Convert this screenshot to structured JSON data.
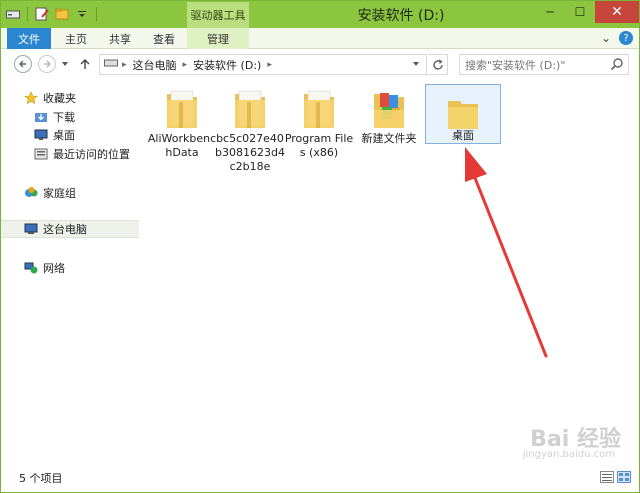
{
  "window": {
    "title": "安装软件 (D:)",
    "context_tab": "驱动器工具",
    "controls": {
      "minimize": "─",
      "maximize": "☐",
      "close": "✕"
    }
  },
  "ribbon": {
    "tabs": [
      "文件",
      "主页",
      "共享",
      "查看",
      "管理"
    ],
    "expand_glyph": "⌄",
    "help_glyph": "?"
  },
  "address": {
    "crumbs": [
      "这台电脑",
      "安装软件 (D:)"
    ],
    "search_placeholder": "搜索\"安装软件 (D:)\""
  },
  "nav_pane": {
    "favorites_label": "收藏夹",
    "favorites": [
      "下载",
      "桌面",
      "最近访问的位置"
    ],
    "homegroup": "家庭组",
    "this_pc": "这台电脑",
    "network": "网络"
  },
  "files": [
    {
      "name": "AliWorkbenchData",
      "icon": "folder-icon"
    },
    {
      "name": "bc5c027e40b3081623d4c2b18e",
      "icon": "folder-icon"
    },
    {
      "name": "Program Files (x86)",
      "icon": "folder-icon"
    },
    {
      "name": "新建文件夹",
      "icon": "folder-colorful-icon"
    },
    {
      "name": "桌面",
      "icon": "folder-icon",
      "selected": true
    }
  ],
  "status": {
    "item_count": "5 个项目"
  },
  "watermark": {
    "brand": "Bai 经验",
    "url": "jingyan.baidu.com"
  },
  "colors": {
    "title_bar": "#8cc63f",
    "file_tab": "#2a86d0",
    "context_tab": "#b9de7f",
    "close_button": "#c6463c",
    "annotation_arrow": "#e53935"
  }
}
